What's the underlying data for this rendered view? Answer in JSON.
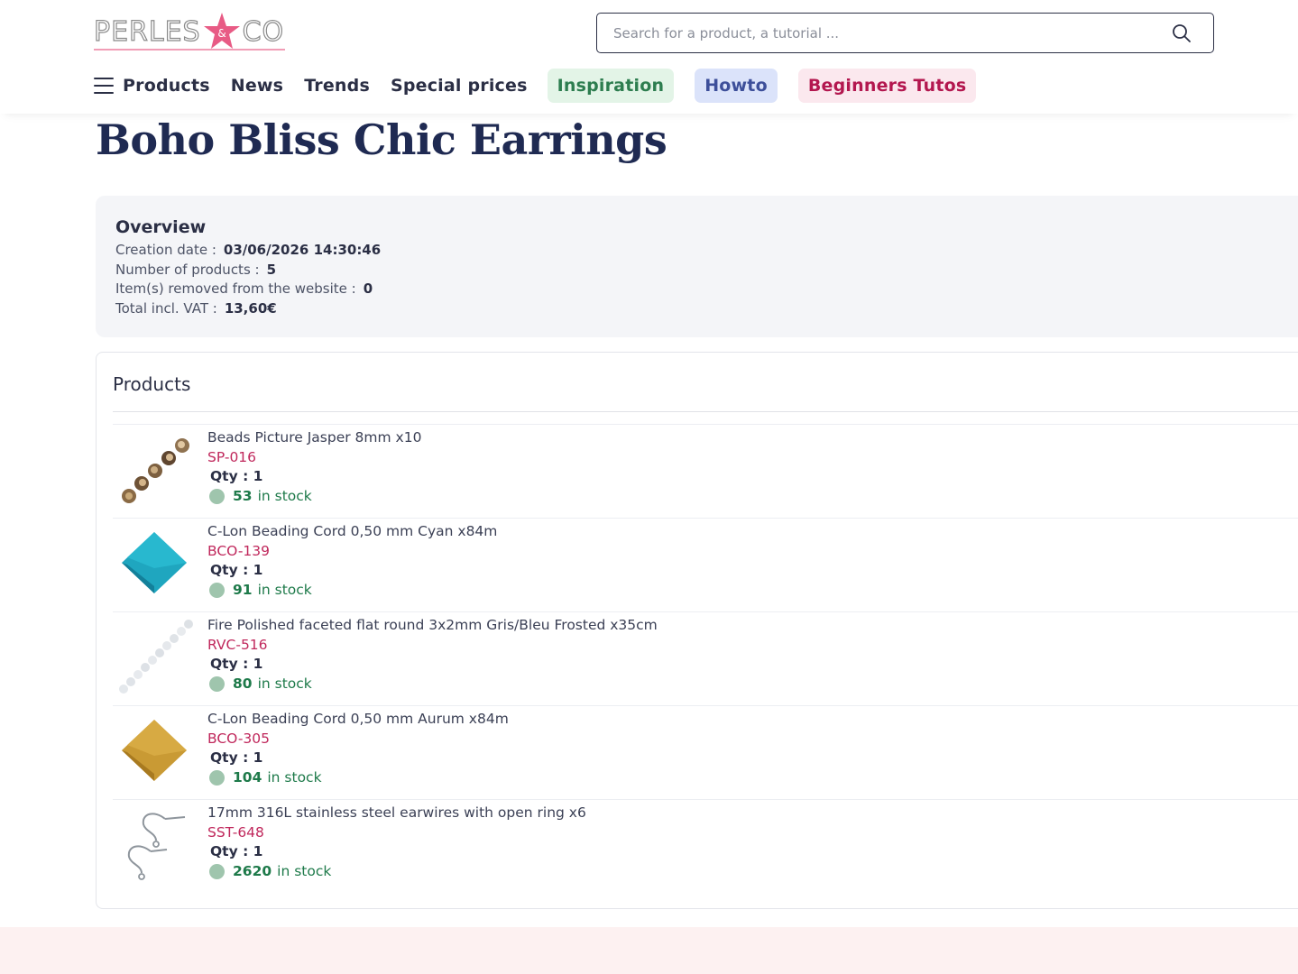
{
  "header": {
    "logo_text_left": "PERLES",
    "logo_text_right": "CO",
    "logo_mark": "&",
    "search_placeholder": "Search for a product, a tutorial ...",
    "search_icon": "search-icon",
    "menu_icon": "hamburger-menu-icon"
  },
  "nav": {
    "items": [
      "Products",
      "News",
      "Trends",
      "Special prices"
    ],
    "pills": [
      {
        "label": "Inspiration",
        "color": "#e3f4e7"
      },
      {
        "label": "Howto",
        "color": "#dbe3fa"
      },
      {
        "label": "Beginners Tutos",
        "color": "#fbe8ee"
      }
    ]
  },
  "page": {
    "title": "Boho Bliss Chic Earrings"
  },
  "overview": {
    "heading": "Overview",
    "creation_date_label": "Creation date :",
    "creation_date": "03/06/2026 14:30:46",
    "num_products_label": "Number of products :",
    "num_products": "5",
    "removed_label": "Item(s) removed from the website :",
    "removed": "0",
    "total_label": "Total incl. VAT :",
    "total": "13,60€"
  },
  "products": {
    "heading": "Products",
    "qty_label": "Qty : 1",
    "in_stock_label": "in stock",
    "items": [
      {
        "name": "Beads Picture Jasper 8mm x10",
        "ref": "SP-016",
        "qty": "Qty : 1",
        "stock": "53",
        "stock_text": "in stock",
        "thumb": "jasper-beads-image"
      },
      {
        "name": "C-Lon Beading Cord 0,50 mm Cyan x84m",
        "ref": "BCO-139",
        "qty": "Qty : 1",
        "stock": "91",
        "stock_text": "in stock",
        "thumb": "cyan-cord-spool-image"
      },
      {
        "name": "Fire Polished faceted flat round 3x2mm Gris/Bleu Frosted x35cm",
        "ref": "RVC-516",
        "qty": "Qty : 1",
        "stock": "80",
        "stock_text": "in stock",
        "thumb": "frosted-beads-strand-image"
      },
      {
        "name": "C-Lon Beading Cord 0,50 mm Aurum x84m",
        "ref": "BCO-305",
        "qty": "Qty : 1",
        "stock": "104",
        "stock_text": "in stock",
        "thumb": "aurum-cord-spool-image"
      },
      {
        "name": "17mm 316L stainless steel earwires with open ring x6",
        "ref": "SST-648",
        "qty": "Qty : 1",
        "stock": "2620",
        "stock_text": "in stock",
        "thumb": "earwires-image"
      }
    ]
  },
  "colors": {
    "accent_pink": "#e85b85",
    "ref_red": "#c0285c",
    "stock_green": "#1e7a4a",
    "title_navy": "#1f2a52"
  }
}
